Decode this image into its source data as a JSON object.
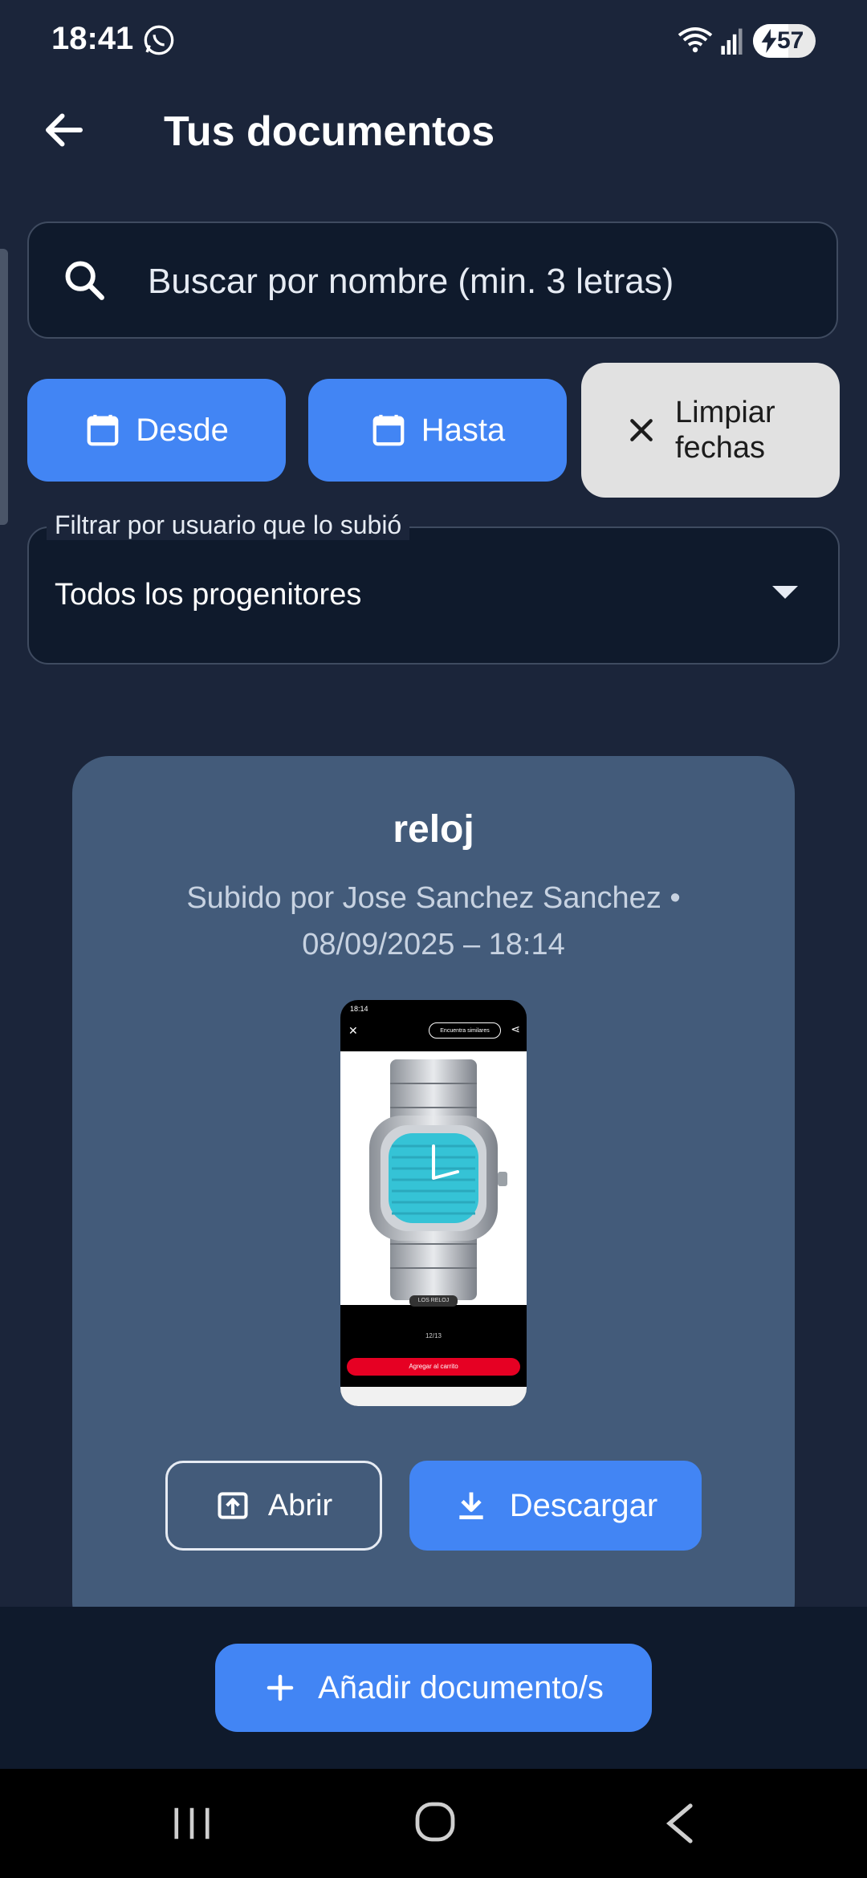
{
  "status_bar": {
    "time": "18:41",
    "battery": "57"
  },
  "app_bar": {
    "title": "Tus documentos"
  },
  "search": {
    "placeholder": "Buscar por nombre (min. 3 letras)"
  },
  "filters": {
    "from_label": "Desde",
    "to_label": "Hasta",
    "clear_label": "Limpiar fechas",
    "user_filter_label": "Filtrar por usuario que lo subió",
    "user_filter_value": "Todos los progenitores"
  },
  "document": {
    "title": "reloj",
    "meta": "Subido por Jose Sanchez Sanchez • 08/09/2025 – 18:14",
    "thumbnail": {
      "status_time": "18:14",
      "pill_text": "Encuentra similares",
      "caption": "LOS RELOJ",
      "page": "12/13",
      "cart_label": "Agregar al carrito"
    },
    "open_label": "Abrir",
    "download_label": "Descargar"
  },
  "add_button": {
    "label": "Añadir documento/s"
  },
  "colors": {
    "background": "#1b253a",
    "accent": "#4285f4",
    "card": "#435b7a",
    "field": "#0f1a2c"
  }
}
